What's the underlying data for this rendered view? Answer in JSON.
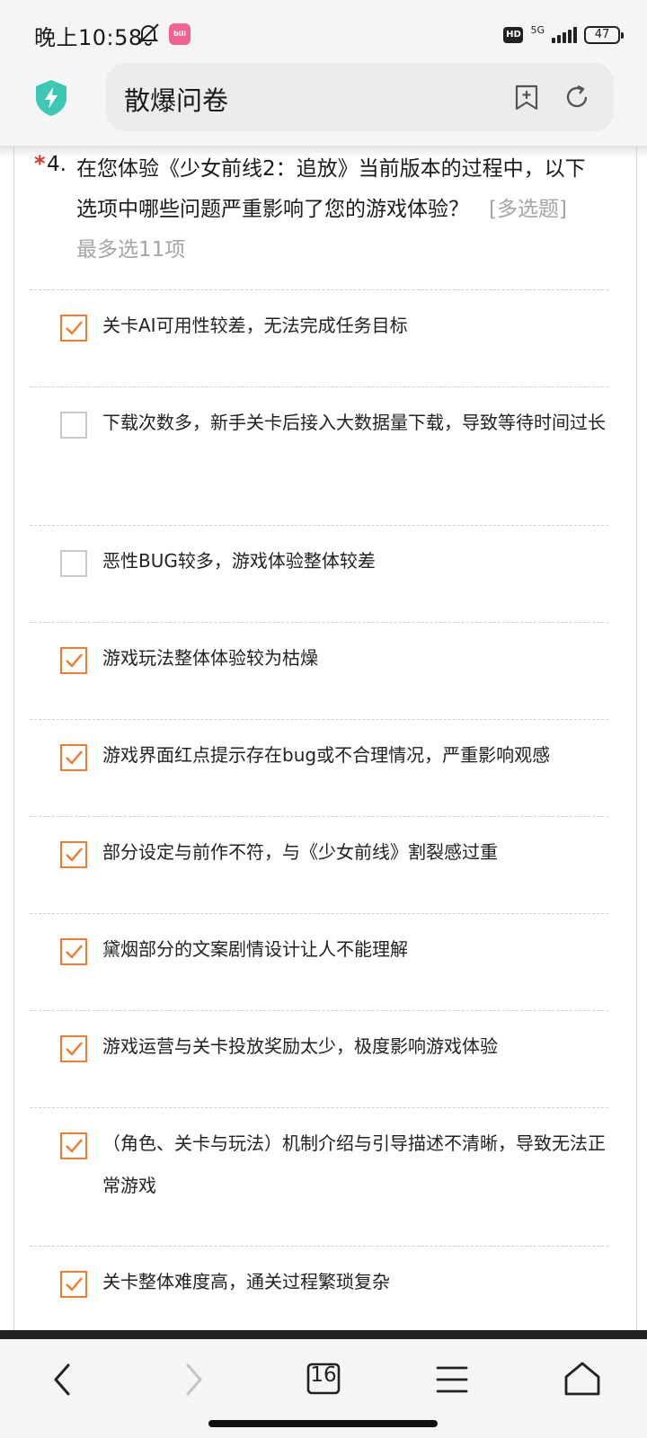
{
  "status_bar": {
    "time": "晚上10:58",
    "hd": "HD",
    "network": "5G",
    "battery": "47"
  },
  "browser": {
    "title": "散爆问卷",
    "tab_count": "16"
  },
  "question": {
    "required_mark": "*",
    "number": "4.",
    "title": "在您体验《少女前线2：追放》当前版本的过程中，以下选项中哪些问题严重影响了您的游戏体验？",
    "hint": "[多选题] 最多选11项"
  },
  "options": [
    {
      "label": "关卡AI可用性较差，无法完成任务目标",
      "checked": true
    },
    {
      "label": "下载次数多，新手关卡后接入大数据量下载，导致等待时间过长",
      "checked": false
    },
    {
      "label": "恶性BUG较多，游戏体验整体较差",
      "checked": false
    },
    {
      "label": "游戏玩法整体体验较为枯燥",
      "checked": true
    },
    {
      "label": "游戏界面红点提示存在bug或不合理情况，严重影响观感",
      "checked": true
    },
    {
      "label": "部分设定与前作不符，与《少女前线》割裂感过重",
      "checked": true
    },
    {
      "label": "黛烟部分的文案剧情设计让人不能理解",
      "checked": true
    },
    {
      "label": "游戏运营与关卡投放奖励太少，极度影响游戏体验",
      "checked": true
    },
    {
      "label": "（角色、关卡与玩法）机制介绍与引导描述不清晰，导致无法正常游戏",
      "checked": true
    },
    {
      "label": "关卡整体难度高，通关过程繁琐复杂",
      "checked": true
    }
  ],
  "colors": {
    "accent": "#f07a2f",
    "required": "#e5322d",
    "hint": "#a5a5a5",
    "shield": "#3ec8b4"
  }
}
